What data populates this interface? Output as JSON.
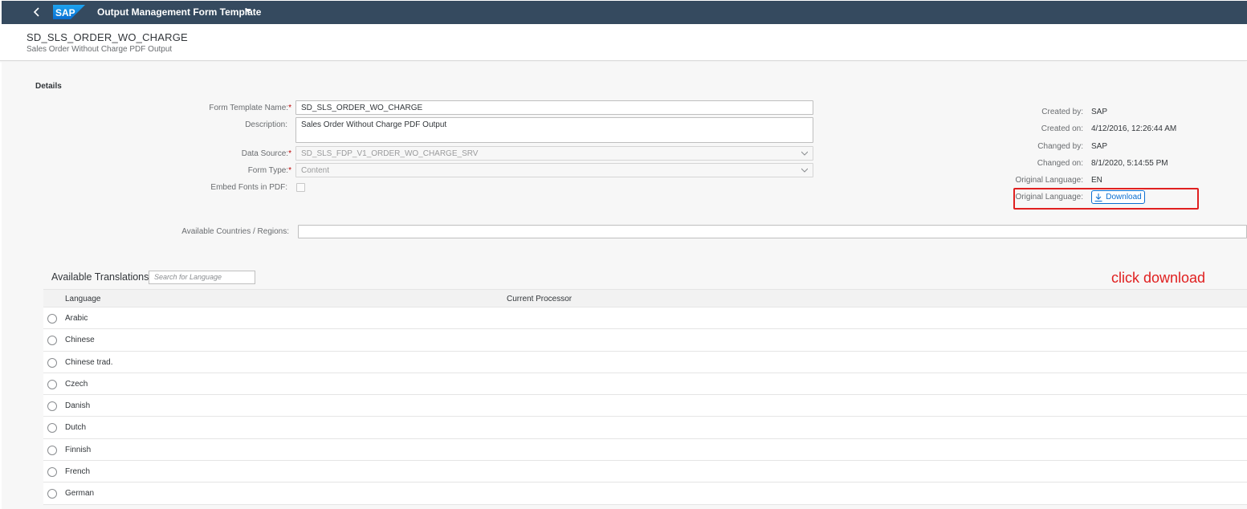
{
  "shell": {
    "title": "Output Management Form Template",
    "logo_text": "SAP",
    "back_icon": "chevron-left-icon"
  },
  "object": {
    "title": "SD_SLS_ORDER_WO_CHARGE",
    "subtitle": "Sales Order Without Charge PDF Output"
  },
  "details": {
    "section_title": "Details",
    "form_template_name": {
      "label": "Form Template Name:",
      "value": "SD_SLS_ORDER_WO_CHARGE",
      "required": "*"
    },
    "description": {
      "label": "Description:",
      "value": "Sales Order Without Charge PDF Output"
    },
    "data_source": {
      "label": "Data Source:",
      "value": "SD_SLS_FDP_V1_ORDER_WO_CHARGE_SRV",
      "required": "*"
    },
    "form_type": {
      "label": "Form Type:",
      "value": "Content",
      "required": "*"
    },
    "embed_fonts": {
      "label": "Embed Fonts in PDF:"
    },
    "countries": {
      "label": "Available Countries / Regions:",
      "value": ""
    }
  },
  "meta": {
    "created_by": {
      "label": "Created by:",
      "value": "SAP"
    },
    "created_on": {
      "label": "Created on:",
      "value": "4/12/2016, 12:26:44 AM"
    },
    "changed_by": {
      "label": "Changed by:",
      "value": "SAP"
    },
    "changed_on": {
      "label": "Changed on:",
      "value": "8/1/2020, 5:14:55 PM"
    },
    "original_language": {
      "label": "Original Language:",
      "value": "EN"
    },
    "original_language_download": {
      "label": "Original Language:",
      "button": "Download"
    }
  },
  "annotation": {
    "text": "click download",
    "color": "#e02020"
  },
  "translations": {
    "title": "Available Translations",
    "search_placeholder": "Search for Language",
    "columns": [
      "Language",
      "Current Processor"
    ],
    "rows": [
      "Arabic",
      "Chinese",
      "Chinese trad.",
      "Czech",
      "Danish",
      "Dutch",
      "Finnish",
      "French",
      "German"
    ]
  },
  "colors": {
    "shell": "#354a5f",
    "accent": "#0a6ed1",
    "required": "#bb0000"
  }
}
